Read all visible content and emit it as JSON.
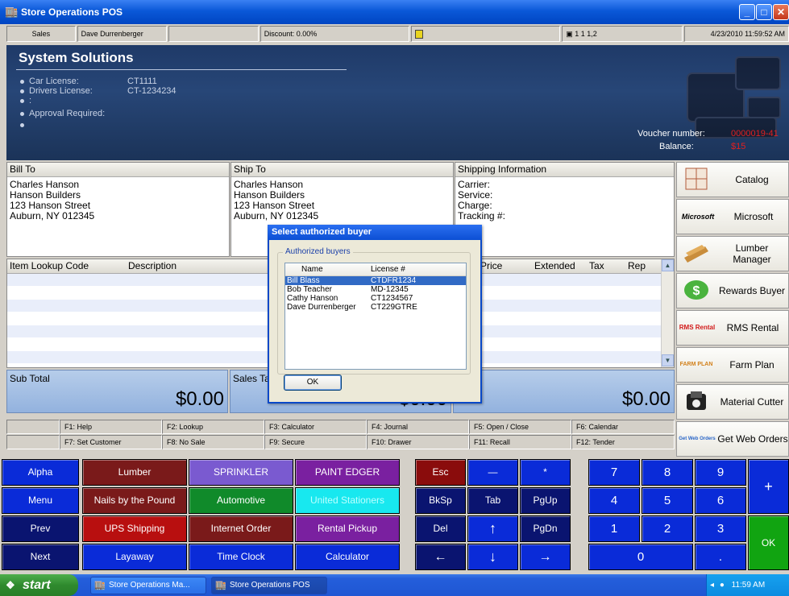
{
  "window": {
    "title": "Store Operations POS"
  },
  "status_bar": {
    "mode": "Sales",
    "cashier": "Dave Durrenberger",
    "discount": "Discount: 0.00%",
    "register_info": "1  1  1,2",
    "datetime": "4/23/2010 11:59:52 AM"
  },
  "header": {
    "title": "System Solutions",
    "lines": [
      {
        "label": "Car License:",
        "value": "CT1111"
      },
      {
        "label": "Drivers License:",
        "value": "CT-1234234"
      },
      {
        "label": ":",
        "value": ""
      },
      {
        "label": "Approval Required:",
        "value": ""
      },
      {
        "label": "",
        "value": ""
      }
    ],
    "voucher_label": "Voucher number:",
    "voucher_value": "0000019-41",
    "balance_label": "Balance:",
    "balance_value": "$15"
  },
  "bill_to": {
    "title": "Bill To",
    "lines": [
      "Charles  Hanson",
      "Hanson Builders",
      "123 Hanson Street",
      "Auburn, NY  012345"
    ]
  },
  "ship_to": {
    "title": "Ship To",
    "lines": [
      "Charles  Hanson",
      "Hanson Builders",
      "123 Hanson Street",
      "Auburn, NY  012345"
    ]
  },
  "shipping": {
    "title": "Shipping Information",
    "lines": [
      "Carrier:",
      "Service:",
      "Charge:",
      "Tracking #:"
    ]
  },
  "grid": {
    "columns": [
      "Item Lookup Code",
      "Description",
      "Price",
      "Extended",
      "Tax",
      "Rep"
    ]
  },
  "totals": {
    "subtotal_label": "Sub Total",
    "subtotal_value": "$0.00",
    "sales_tax_label": "Sales Tax",
    "sales_tax_value": "$0.00",
    "total_value": "$0.00"
  },
  "function_keys": {
    "row1": [
      "F1: Help",
      "F2: Lookup",
      "F3: Calculator",
      "F4: Journal",
      "F5: Open / Close",
      "F6: Calendar"
    ],
    "row2": [
      "F7: Set Customer",
      "F8: No Sale",
      "F9: Secure",
      "F10: Drawer",
      "F11: Recall",
      "F12: Tender"
    ]
  },
  "side_buttons": [
    {
      "label": "Catalog",
      "icon_text": ""
    },
    {
      "label": "Microsoft",
      "icon_text": "Microsoft"
    },
    {
      "label": "Lumber Manager",
      "icon_text": ""
    },
    {
      "label": "Rewards Buyer",
      "icon_text": ""
    },
    {
      "label": "RMS Rental",
      "icon_text": "RMS Rental"
    },
    {
      "label": "Farm Plan",
      "icon_text": "FARM PLAN"
    },
    {
      "label": "Material Cutter",
      "icon_text": ""
    },
    {
      "label": "Get Web Orders",
      "icon_text": "Get Web Orders"
    }
  ],
  "keypad": {
    "nav": [
      "Alpha",
      "Menu",
      "Prev",
      "Next"
    ],
    "col1": [
      "Lumber",
      "Nails by the Pound",
      "UPS Shipping",
      "Layaway"
    ],
    "col2": [
      "SPRINKLER",
      "Automotive",
      "Internet Order",
      "Time Clock"
    ],
    "col3": [
      "PAINT EDGER",
      "United Stationers",
      "Rental Pickup",
      "Calculator"
    ],
    "edit": [
      "Esc",
      "BkSp",
      "Del",
      "←"
    ],
    "arrows": [
      "—",
      "*",
      "Tab",
      "PgUp",
      "↑",
      "PgDn",
      "↓",
      "→"
    ],
    "numbers": [
      "7",
      "8",
      "9",
      "4",
      "5",
      "6",
      "1",
      "2",
      "3",
      "0",
      "."
    ],
    "plus": "+",
    "ok": "OK"
  },
  "dialog": {
    "title": "Select authorized buyer",
    "group_label": "Authorized buyers",
    "columns": [
      "Name",
      "License #"
    ],
    "rows": [
      {
        "name": "Bill Blass",
        "license": "CTDFR1234"
      },
      {
        "name": "Bob Teacher",
        "license": "MD-12345"
      },
      {
        "name": "Cathy Hanson",
        "license": "CT1234567"
      },
      {
        "name": "Dave Durrenberger",
        "license": "CT229GTRE"
      }
    ],
    "ok_label": "OK"
  },
  "taskbar": {
    "start_label": "start",
    "tasks": [
      "Store Operations Ma...",
      "Store Operations POS"
    ],
    "clock": "11:59 AM"
  },
  "colors": {
    "keypad_blue": "#0a2bd8",
    "keypad_navy": "#0a1470",
    "keypad_maroon": "#7a1a1a",
    "keypad_red": "#b80f0f",
    "keypad_purple": "#7a20a0",
    "keypad_cyan": "#18e8ef",
    "keypad_green": "#11a411",
    "selection": "#316ac5"
  }
}
